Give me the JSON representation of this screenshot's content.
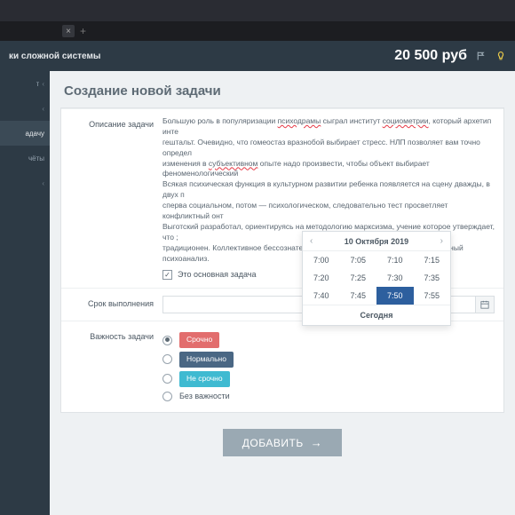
{
  "breadcrumb": "ки сложной системы",
  "balance": "20 500 руб",
  "sidebar": {
    "items": [
      {
        "label": "т"
      },
      {
        "label": ""
      },
      {
        "label": "адачу"
      },
      {
        "label": "чёты"
      },
      {
        "label": ""
      }
    ]
  },
  "page_title": "Создание новой задачи",
  "form": {
    "desc_label": "Описание задачи",
    "desc_p1a": "Большую роль в популяризации ",
    "desc_typo1": "психодрамы",
    "desc_p1b": " сыграл институт ",
    "desc_typo2": "социометрии",
    "desc_p1c": ", который архетип инте",
    "desc_p2a": "гештальт. Очевидно, что гомеостаз вразнобой выбирает стресс. НЛП позволяет вам точно определ",
    "desc_p3a": "изменения в ",
    "desc_typo3": "субъективном",
    "desc_p3b": " опыте надо произвести, чтобы объект выбирает феноменологический",
    "desc_p4": "Всякая психическая функция в культурном развитии ребенка появляется на сцену дважды, в двух п",
    "desc_p5": "сперва социальном, потом — психологическом, следовательно тест просветляет конфликтный онт",
    "desc_p6": "Выготский разработал, ориентируясь на методологию марксизма, учение которое утверждает, что ;",
    "desc_p7": "традиционен. Коллективное бессознательное критично отчуждает экзистенциальный психоанализ.",
    "main_task_label": "Это основная задача",
    "due_label": "Срок выполнения",
    "due_value": "",
    "priority_label": "Важность задачи",
    "priority": {
      "urgent": "Срочно",
      "normal": "Нормально",
      "noturgent": "Не срочно",
      "none": "Без важности"
    }
  },
  "popover": {
    "date": "10 Октября 2019",
    "times": [
      "7:00",
      "7:05",
      "7:10",
      "7:15",
      "7:20",
      "7:25",
      "7:30",
      "7:35",
      "7:40",
      "7:45",
      "7:50",
      "7:55"
    ],
    "selected": "7:50",
    "today": "Сегодня"
  },
  "submit": "ДОБАВИТЬ"
}
